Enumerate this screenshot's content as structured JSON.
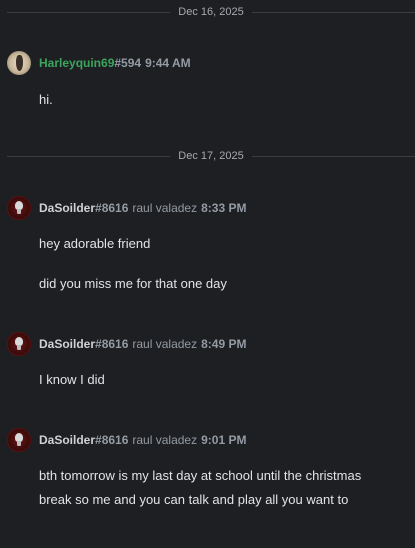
{
  "dividers": [
    {
      "label": "Dec 16, 2025"
    },
    {
      "label": "Dec 17, 2025"
    }
  ],
  "messages": [
    {
      "username": "Harleyquin69",
      "tag": "#594",
      "realname": "",
      "time": "9:44 AM",
      "lines": [
        "hi."
      ]
    },
    {
      "username": "DaSoilder",
      "tag": "#8616",
      "realname": "raul valadez",
      "time": "8:33 PM",
      "lines": [
        "hey adorable friend",
        "did you miss me for that one day"
      ]
    },
    {
      "username": "DaSoilder",
      "tag": "#8616",
      "realname": "raul valadez",
      "time": "8:49 PM",
      "lines": [
        "I know I did"
      ]
    },
    {
      "username": "DaSoilder",
      "tag": "#8616",
      "realname": "raul valadez",
      "time": "9:01 PM",
      "lines": [
        "bth tomorrow is my last day at school until the christmas break so me and you can talk and play all you want to"
      ]
    }
  ],
  "colors": {
    "background": "#1e1f22",
    "username_green": "#3ba55d",
    "muted": "#949ba4"
  }
}
